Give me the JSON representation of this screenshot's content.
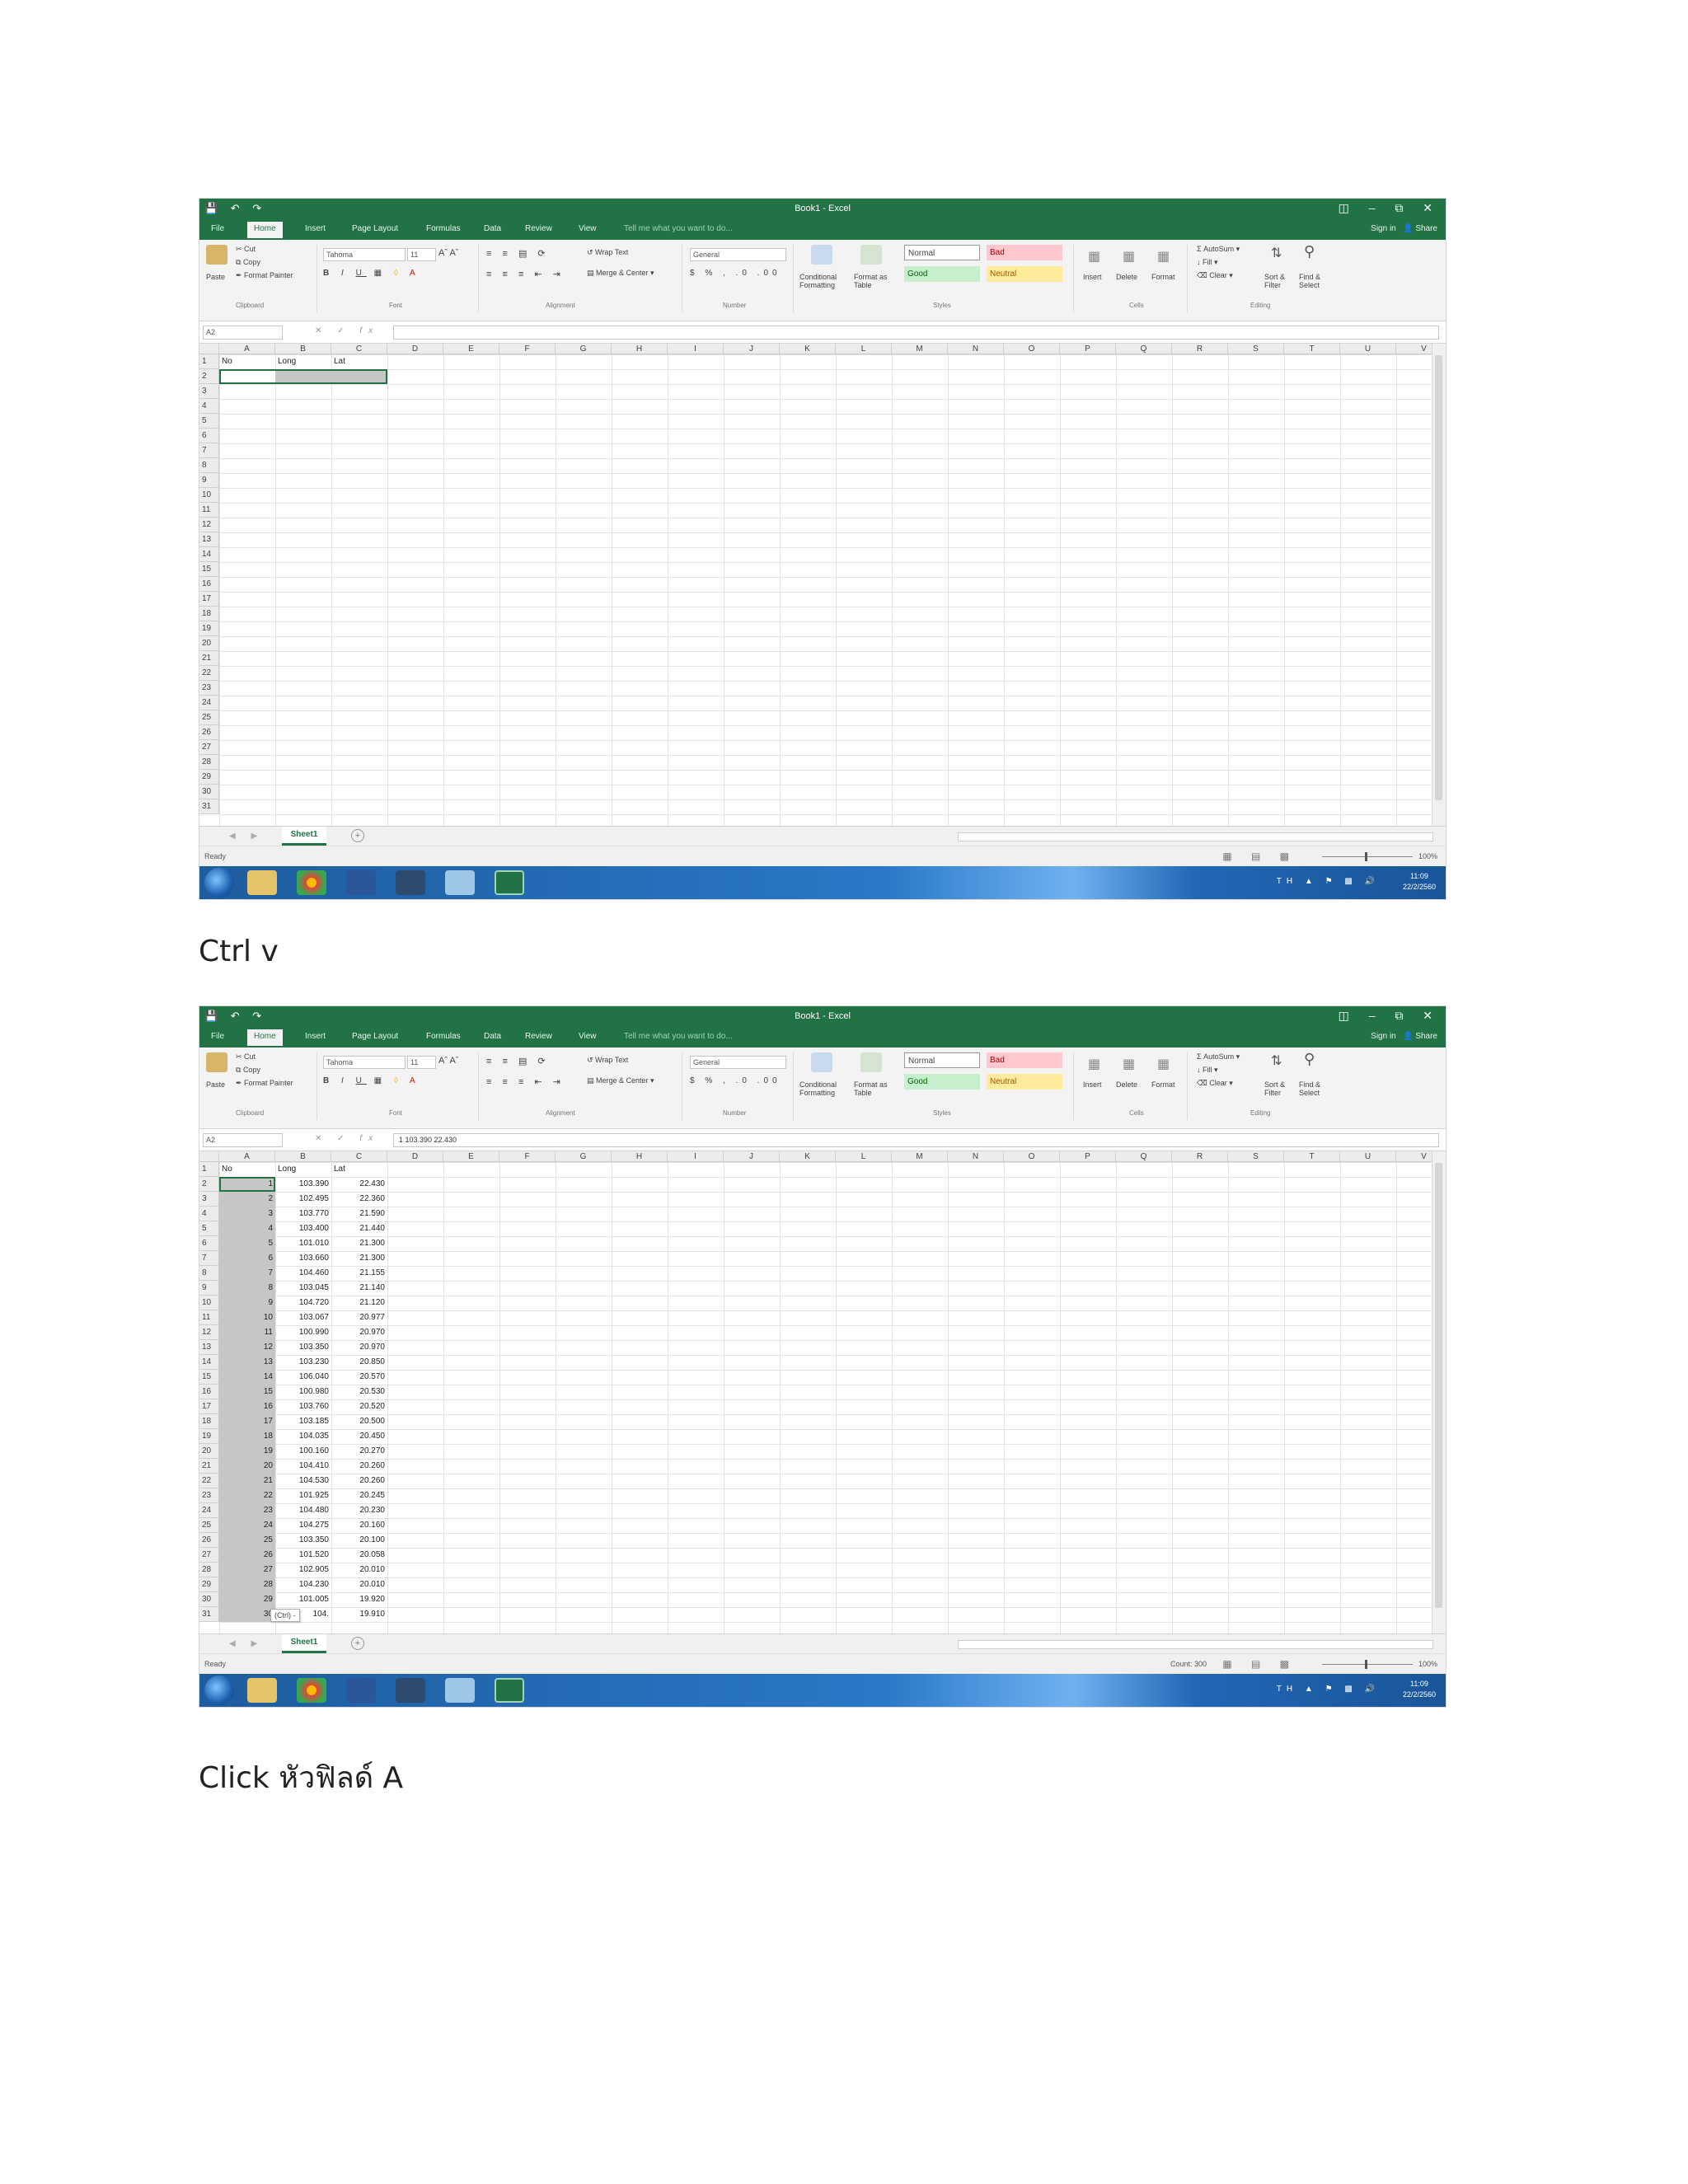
{
  "captions": {
    "first": "Ctrl v",
    "second": "Click หัวฟิลด์ A"
  },
  "excel": {
    "title": "Book1 - Excel",
    "tabs": [
      "File",
      "Home",
      "Insert",
      "Page Layout",
      "Formulas",
      "Data",
      "Review",
      "View"
    ],
    "tell_me": "Tell me what you want to do...",
    "sign_in": "Sign in",
    "share": "Share",
    "clipboard": {
      "paste": "Paste",
      "cut": "Cut",
      "copy": "Copy",
      "format_painter": "Format Painter",
      "group": "Clipboard"
    },
    "font": {
      "name": "Tahoma",
      "size": "11",
      "group": "Font"
    },
    "alignment": {
      "wrap_text": "Wrap Text",
      "merge_center": "Merge & Center",
      "group": "Alignment"
    },
    "number": {
      "format": "General",
      "group": "Number"
    },
    "styles": {
      "conditional": "Conditional Formatting",
      "format_table": "Format as Table",
      "normal": "Normal",
      "bad": "Bad",
      "good": "Good",
      "neutral": "Neutral",
      "group": "Styles"
    },
    "cells": {
      "insert": "Insert",
      "delete": "Delete",
      "format": "Format",
      "group": "Cells"
    },
    "editing": {
      "autosum": "AutoSum",
      "fill": "Fill",
      "clear": "Clear",
      "sort_filter": "Sort & Filter",
      "find_select": "Find & Select",
      "group": "Editing"
    },
    "columns": [
      "A",
      "B",
      "C",
      "D",
      "E",
      "F",
      "G",
      "H",
      "I",
      "J",
      "K",
      "L",
      "M",
      "N",
      "O",
      "P",
      "Q",
      "R",
      "S",
      "T",
      "U",
      "V"
    ],
    "rows": [
      "1",
      "2",
      "3",
      "4",
      "5",
      "6",
      "7",
      "8",
      "9",
      "10",
      "11",
      "12",
      "13",
      "14",
      "15",
      "16",
      "17",
      "18",
      "19",
      "20",
      "21",
      "22",
      "23",
      "24",
      "25",
      "26",
      "27",
      "28",
      "29",
      "30",
      "31"
    ],
    "sheet_tab": "Sheet1",
    "status_ready": "Ready",
    "zoom": "100%",
    "clock_time": "11:09",
    "clock_date": "22/2/2560",
    "tray_lang": "TH",
    "colors": {
      "excel_green": "#217346",
      "bad_fill": "#ffc7ce",
      "good_fill": "#c6efce",
      "neutral_fill": "#ffeb9c"
    }
  },
  "screen1": {
    "name_box": "A2",
    "formula": "",
    "headers": [
      "No",
      "Long",
      "Lat"
    ]
  },
  "screen2": {
    "name_box": "A2",
    "formula": "1  103.390  22.430",
    "status_count": "Count: 300",
    "paste_hint": "(Ctrl) -",
    "headers": [
      "No",
      "Long",
      "Lat"
    ],
    "rows": [
      [
        "1",
        "103.390",
        "22.430"
      ],
      [
        "2",
        "102.495",
        "22.360"
      ],
      [
        "3",
        "103.770",
        "21.590"
      ],
      [
        "4",
        "103.400",
        "21.440"
      ],
      [
        "5",
        "101.010",
        "21.300"
      ],
      [
        "6",
        "103.660",
        "21.300"
      ],
      [
        "7",
        "104.460",
        "21.155"
      ],
      [
        "8",
        "103.045",
        "21.140"
      ],
      [
        "9",
        "104.720",
        "21.120"
      ],
      [
        "10",
        "103.067",
        "20.977"
      ],
      [
        "11",
        "100.990",
        "20.970"
      ],
      [
        "12",
        "103.350",
        "20.970"
      ],
      [
        "13",
        "103.230",
        "20.850"
      ],
      [
        "14",
        "106.040",
        "20.570"
      ],
      [
        "15",
        "100.980",
        "20.530"
      ],
      [
        "16",
        "103.760",
        "20.520"
      ],
      [
        "17",
        "103.185",
        "20.500"
      ],
      [
        "18",
        "104.035",
        "20.450"
      ],
      [
        "19",
        "100.160",
        "20.270"
      ],
      [
        "20",
        "104.410",
        "20.260"
      ],
      [
        "21",
        "104.530",
        "20.260"
      ],
      [
        "22",
        "101.925",
        "20.245"
      ],
      [
        "23",
        "104.480",
        "20.230"
      ],
      [
        "24",
        "104.275",
        "20.160"
      ],
      [
        "25",
        "103.350",
        "20.100"
      ],
      [
        "26",
        "101.520",
        "20.058"
      ],
      [
        "27",
        "102.905",
        "20.010"
      ],
      [
        "28",
        "104.230",
        "20.010"
      ],
      [
        "29",
        "101.005",
        "19.920"
      ],
      [
        "30",
        "104.",
        "19.910"
      ]
    ]
  }
}
